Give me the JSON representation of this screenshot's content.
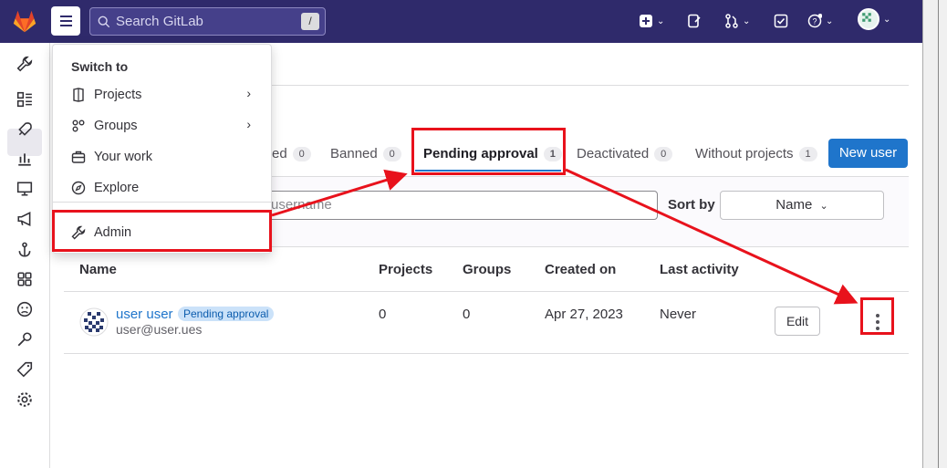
{
  "topbar": {
    "search_placeholder": "Search GitLab",
    "search_shortcut": "/"
  },
  "menu": {
    "heading": "Switch to",
    "items": [
      {
        "label": "Projects",
        "icon": "project-icon"
      },
      {
        "label": "Groups",
        "icon": "group-icon"
      },
      {
        "label": "Your work",
        "icon": "briefcase-icon"
      },
      {
        "label": "Explore",
        "icon": "compass-icon"
      },
      {
        "label": "Admin",
        "icon": "wrench-icon"
      }
    ]
  },
  "tabs": [
    {
      "label": "Blocked",
      "count": "0",
      "visible": "ed"
    },
    {
      "label": "Banned",
      "count": "0"
    },
    {
      "label": "Pending approval",
      "count": "1"
    },
    {
      "label": "Deactivated",
      "count": "0"
    },
    {
      "label": "Without projects",
      "count": "1"
    }
  ],
  "new_user_label": "New user",
  "filter": {
    "search_placeholder": "username",
    "sort_label": "Sort by",
    "sort_value": "Name"
  },
  "table": {
    "headers": [
      "Name",
      "Projects",
      "Groups",
      "Created on",
      "Last activity"
    ],
    "rows": [
      {
        "name": "user user",
        "badge": "Pending approval",
        "email": "user@user.ues",
        "projects": "0",
        "groups": "0",
        "created": "Apr 27, 2023",
        "last_activity": "Never",
        "edit_label": "Edit"
      }
    ]
  },
  "colors": {
    "topbar": "#2f2a6b",
    "primary": "#1f75cb",
    "annotation": "#e8121c"
  }
}
